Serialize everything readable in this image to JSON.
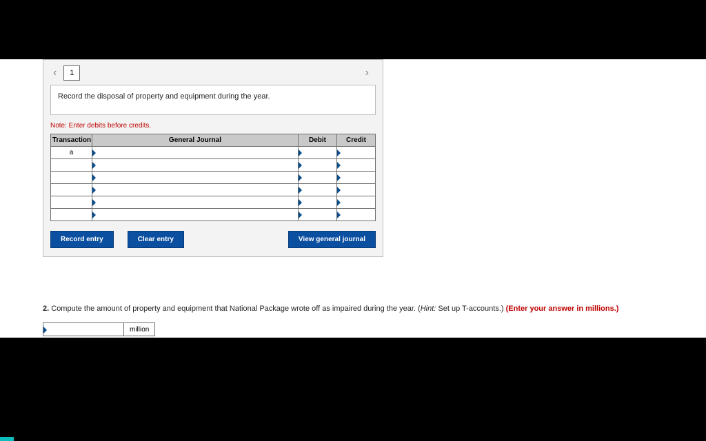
{
  "pager": {
    "current": "1"
  },
  "prompt": "Record the disposal of property and equipment during the year.",
  "note": "Note: Enter debits before credits.",
  "table": {
    "headers": {
      "transaction": "Transaction",
      "general_journal": "General Journal",
      "debit": "Debit",
      "credit": "Credit"
    },
    "rows": [
      {
        "transaction": "a",
        "general_journal": "",
        "debit": "",
        "credit": ""
      },
      {
        "transaction": "",
        "general_journal": "",
        "debit": "",
        "credit": ""
      },
      {
        "transaction": "",
        "general_journal": "",
        "debit": "",
        "credit": ""
      },
      {
        "transaction": "",
        "general_journal": "",
        "debit": "",
        "credit": ""
      },
      {
        "transaction": "",
        "general_journal": "",
        "debit": "",
        "credit": ""
      },
      {
        "transaction": "",
        "general_journal": "",
        "debit": "",
        "credit": ""
      }
    ]
  },
  "buttons": {
    "record": "Record entry",
    "clear": "Clear entry",
    "view": "View general journal"
  },
  "q2": {
    "num": "2.",
    "text_a": " Compute the amount of property and equipment that National Package wrote off as impaired during the year. (",
    "hint_label": "Hint:",
    "hint_text": " Set up T-accounts.) ",
    "red": "(Enter your answer in millions.)",
    "unit": "million"
  }
}
